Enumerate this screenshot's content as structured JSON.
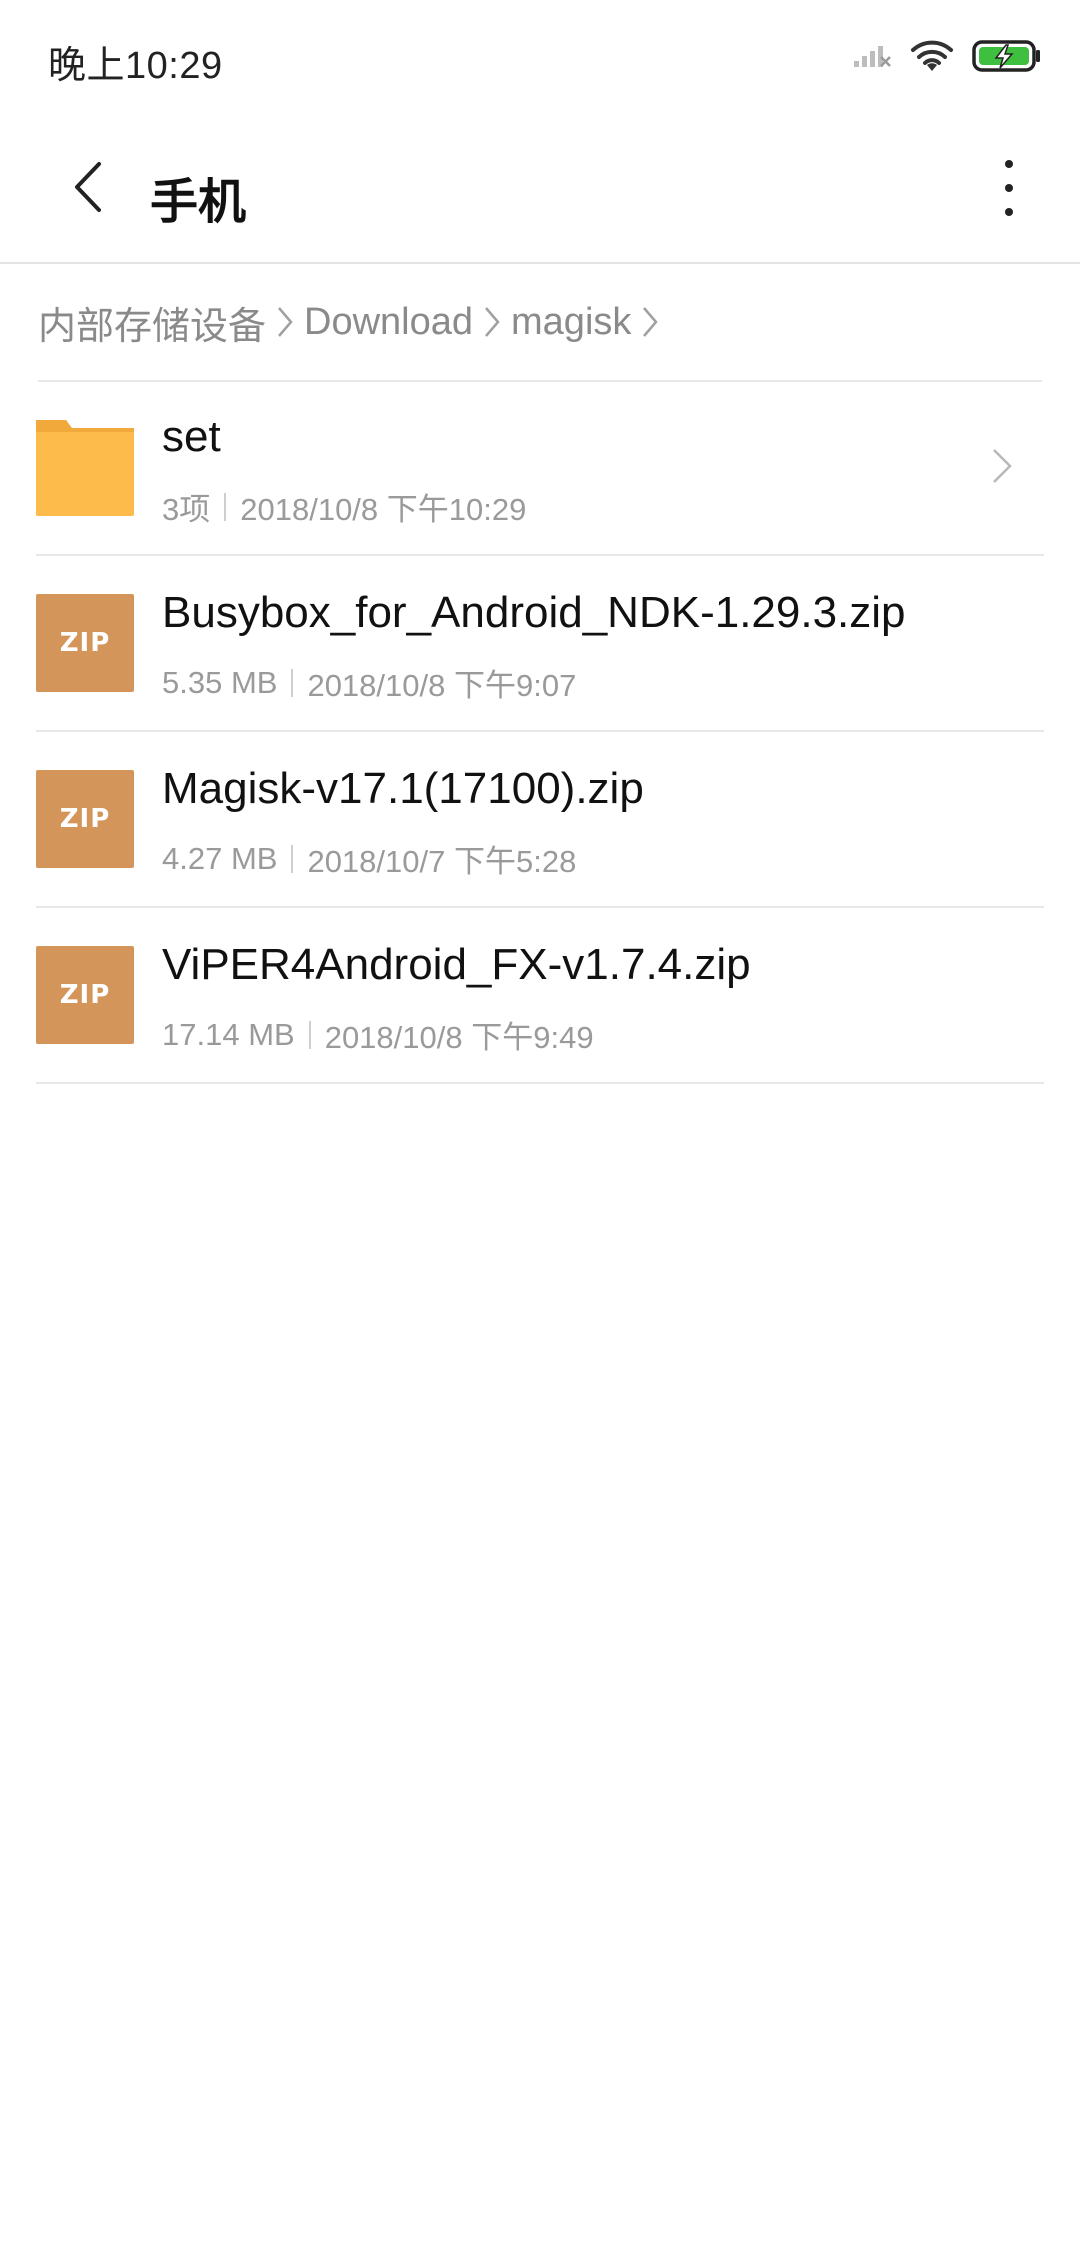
{
  "status_bar": {
    "time": "晚上10:29",
    "icons": [
      "signal-icon",
      "wifi-icon",
      "battery-charging-icon"
    ],
    "battery_color": "#3fbf3f"
  },
  "app_bar": {
    "title": "手机",
    "back_icon": "back-arrow-icon",
    "more_icon": "more-vertical-icon"
  },
  "breadcrumb": {
    "items": [
      "内部存储设备",
      "Download",
      "magisk"
    ]
  },
  "files": [
    {
      "type": "folder",
      "icon": "folder-icon",
      "name": "set",
      "detail": "3项",
      "date": "2018/10/8 下午10:29",
      "has_chevron": true
    },
    {
      "type": "zip",
      "icon": "zip-icon",
      "icon_label": "ZIP",
      "name": "Busybox_for_Android_NDK-1.29.3.zip",
      "detail": "5.35 MB",
      "date": "2018/10/8 下午9:07"
    },
    {
      "type": "zip",
      "icon": "zip-icon",
      "icon_label": "ZIP",
      "name": "Magisk-v17.1(17100).zip",
      "detail": "4.27 MB",
      "date": "2018/10/7 下午5:28"
    },
    {
      "type": "zip",
      "icon": "zip-icon",
      "icon_label": "ZIP",
      "name": "ViPER4Android_FX-v1.7.4.zip",
      "detail": "17.14 MB",
      "date": "2018/10/8 下午9:49"
    }
  ],
  "colors": {
    "folder": "#fdbb4c",
    "zip": "#d4955a",
    "secondary_text": "#9a9a9a"
  }
}
